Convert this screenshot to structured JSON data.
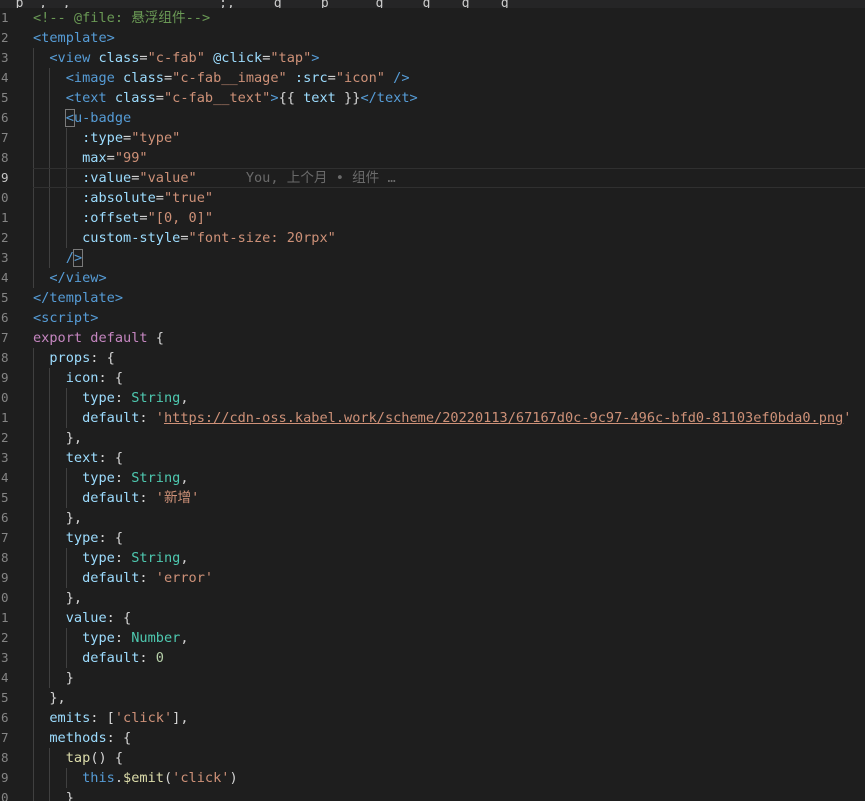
{
  "editor": {
    "top_strip_text": "  p  ,  ,                   ;,     g     p      g     g    g    g",
    "lines": [
      {
        "n": "1",
        "tokens": [
          [
            "c",
            "<!-- @file: 悬浮组件-->"
          ]
        ]
      },
      {
        "n": "2",
        "tokens": [
          [
            "tg",
            "<template>"
          ]
        ]
      },
      {
        "n": "3",
        "tokens": [
          [
            "p",
            "  "
          ],
          [
            "tg",
            "<view"
          ],
          [
            "p",
            " "
          ],
          [
            "at",
            "class"
          ],
          [
            "p",
            "="
          ],
          [
            "st",
            "\"c-fab\""
          ],
          [
            "p",
            " "
          ],
          [
            "at",
            "@click"
          ],
          [
            "p",
            "="
          ],
          [
            "st",
            "\"tap\""
          ],
          [
            "tg",
            ">"
          ]
        ]
      },
      {
        "n": "4",
        "tokens": [
          [
            "p",
            "    "
          ],
          [
            "tg",
            "<image"
          ],
          [
            "p",
            " "
          ],
          [
            "at",
            "class"
          ],
          [
            "p",
            "="
          ],
          [
            "st",
            "\"c-fab__image\""
          ],
          [
            "p",
            " "
          ],
          [
            "at",
            ":src"
          ],
          [
            "p",
            "="
          ],
          [
            "st",
            "\"icon\""
          ],
          [
            "p",
            " "
          ],
          [
            "tg",
            "/>"
          ]
        ]
      },
      {
        "n": "5",
        "tokens": [
          [
            "p",
            "    "
          ],
          [
            "tg",
            "<text"
          ],
          [
            "p",
            " "
          ],
          [
            "at",
            "class"
          ],
          [
            "p",
            "="
          ],
          [
            "st",
            "\"c-fab__text\""
          ],
          [
            "tg",
            ">"
          ],
          [
            "p",
            "{{ "
          ],
          [
            "at",
            "text"
          ],
          [
            "p",
            " }}"
          ],
          [
            "tg",
            "</text>"
          ]
        ]
      },
      {
        "n": "6",
        "tokens": [
          [
            "p",
            "    "
          ],
          [
            "tghl",
            "<"
          ],
          [
            "tg",
            "u-badge"
          ]
        ]
      },
      {
        "n": "7",
        "tokens": [
          [
            "p",
            "      "
          ],
          [
            "at",
            ":type"
          ],
          [
            "p",
            "="
          ],
          [
            "st",
            "\"type\""
          ]
        ]
      },
      {
        "n": "8",
        "tokens": [
          [
            "p",
            "      "
          ],
          [
            "at",
            "max"
          ],
          [
            "p",
            "="
          ],
          [
            "st",
            "\"99\""
          ]
        ]
      },
      {
        "n": "9",
        "current": true,
        "tokens": [
          [
            "p",
            "      "
          ],
          [
            "at",
            ":value"
          ],
          [
            "p",
            "="
          ],
          [
            "st",
            "\"value\""
          ],
          [
            "p",
            "      "
          ],
          [
            "lens",
            "You, 上个月 • 组件 …"
          ]
        ]
      },
      {
        "n": "0",
        "tokens": [
          [
            "p",
            "      "
          ],
          [
            "at",
            ":absolute"
          ],
          [
            "p",
            "="
          ],
          [
            "st",
            "\"true\""
          ]
        ]
      },
      {
        "n": "1",
        "tokens": [
          [
            "p",
            "      "
          ],
          [
            "at",
            ":offset"
          ],
          [
            "p",
            "="
          ],
          [
            "st",
            "\"[0, 0]\""
          ]
        ]
      },
      {
        "n": "2",
        "tokens": [
          [
            "p",
            "      "
          ],
          [
            "at",
            "custom-style"
          ],
          [
            "p",
            "="
          ],
          [
            "st",
            "\"font-size: 20rpx\""
          ]
        ]
      },
      {
        "n": "3",
        "tokens": [
          [
            "p",
            "    "
          ],
          [
            "tg",
            "/"
          ],
          [
            "tghl",
            ">"
          ]
        ]
      },
      {
        "n": "4",
        "tokens": [
          [
            "p",
            "  "
          ],
          [
            "tg",
            "</view>"
          ]
        ]
      },
      {
        "n": "5",
        "tokens": [
          [
            "tg",
            "</template>"
          ]
        ]
      },
      {
        "n": "6",
        "tokens": [
          [
            "tg",
            "<script>"
          ]
        ]
      },
      {
        "n": "7",
        "tokens": [
          [
            "kw",
            "export"
          ],
          [
            "p",
            " "
          ],
          [
            "kw",
            "default"
          ],
          [
            "p",
            " {"
          ]
        ]
      },
      {
        "n": "8",
        "tokens": [
          [
            "p",
            "  "
          ],
          [
            "at",
            "props"
          ],
          [
            "p",
            ": {"
          ]
        ]
      },
      {
        "n": "9",
        "tokens": [
          [
            "p",
            "    "
          ],
          [
            "at",
            "icon"
          ],
          [
            "p",
            ": {"
          ]
        ]
      },
      {
        "n": "0",
        "tokens": [
          [
            "p",
            "      "
          ],
          [
            "at",
            "type"
          ],
          [
            "p",
            ": "
          ],
          [
            "ty",
            "String"
          ],
          [
            "p",
            ","
          ]
        ]
      },
      {
        "n": "1",
        "tokens": [
          [
            "p",
            "      "
          ],
          [
            "at",
            "default"
          ],
          [
            "p",
            ": "
          ],
          [
            "st",
            "'"
          ],
          [
            "lk",
            "https://cdn-oss.kabel.work/scheme/20220113/67167d0c-9c97-496c-bfd0-81103ef0bda0.png"
          ],
          [
            "st",
            "'"
          ]
        ]
      },
      {
        "n": "2",
        "tokens": [
          [
            "p",
            "    },"
          ]
        ]
      },
      {
        "n": "3",
        "tokens": [
          [
            "p",
            "    "
          ],
          [
            "at",
            "text"
          ],
          [
            "p",
            ": {"
          ]
        ]
      },
      {
        "n": "4",
        "tokens": [
          [
            "p",
            "      "
          ],
          [
            "at",
            "type"
          ],
          [
            "p",
            ": "
          ],
          [
            "ty",
            "String"
          ],
          [
            "p",
            ","
          ]
        ]
      },
      {
        "n": "5",
        "tokens": [
          [
            "p",
            "      "
          ],
          [
            "at",
            "default"
          ],
          [
            "p",
            ": "
          ],
          [
            "st",
            "'新增'"
          ]
        ]
      },
      {
        "n": "6",
        "tokens": [
          [
            "p",
            "    },"
          ]
        ]
      },
      {
        "n": "7",
        "tokens": [
          [
            "p",
            "    "
          ],
          [
            "at",
            "type"
          ],
          [
            "p",
            ": {"
          ]
        ]
      },
      {
        "n": "8",
        "tokens": [
          [
            "p",
            "      "
          ],
          [
            "at",
            "type"
          ],
          [
            "p",
            ": "
          ],
          [
            "ty",
            "String"
          ],
          [
            "p",
            ","
          ]
        ]
      },
      {
        "n": "9",
        "tokens": [
          [
            "p",
            "      "
          ],
          [
            "at",
            "default"
          ],
          [
            "p",
            ": "
          ],
          [
            "st",
            "'error'"
          ]
        ]
      },
      {
        "n": "0",
        "tokens": [
          [
            "p",
            "    },"
          ]
        ]
      },
      {
        "n": "1",
        "tokens": [
          [
            "p",
            "    "
          ],
          [
            "at",
            "value"
          ],
          [
            "p",
            ": {"
          ]
        ]
      },
      {
        "n": "2",
        "tokens": [
          [
            "p",
            "      "
          ],
          [
            "at",
            "type"
          ],
          [
            "p",
            ": "
          ],
          [
            "ty",
            "Number"
          ],
          [
            "p",
            ","
          ]
        ]
      },
      {
        "n": "3",
        "tokens": [
          [
            "p",
            "      "
          ],
          [
            "at",
            "default"
          ],
          [
            "p",
            ": "
          ],
          [
            "nm",
            "0"
          ]
        ]
      },
      {
        "n": "4",
        "tokens": [
          [
            "p",
            "    }"
          ]
        ]
      },
      {
        "n": "5",
        "tokens": [
          [
            "p",
            "  },"
          ]
        ]
      },
      {
        "n": "6",
        "tokens": [
          [
            "p",
            "  "
          ],
          [
            "at",
            "emits"
          ],
          [
            "p",
            ": ["
          ],
          [
            "st",
            "'click'"
          ],
          [
            "p",
            "],"
          ]
        ]
      },
      {
        "n": "7",
        "tokens": [
          [
            "p",
            "  "
          ],
          [
            "at",
            "methods"
          ],
          [
            "p",
            ": {"
          ]
        ]
      },
      {
        "n": "8",
        "tokens": [
          [
            "p",
            "    "
          ],
          [
            "fn",
            "tap"
          ],
          [
            "p",
            "() {"
          ]
        ]
      },
      {
        "n": "9",
        "tokens": [
          [
            "p",
            "      "
          ],
          [
            "th",
            "this"
          ],
          [
            "p",
            "."
          ],
          [
            "fn",
            "$emit"
          ],
          [
            "p",
            "("
          ],
          [
            "st",
            "'click'"
          ],
          [
            "p",
            ")"
          ]
        ]
      },
      {
        "n": "0",
        "tokens": [
          [
            "p",
            "    }"
          ]
        ]
      }
    ]
  }
}
